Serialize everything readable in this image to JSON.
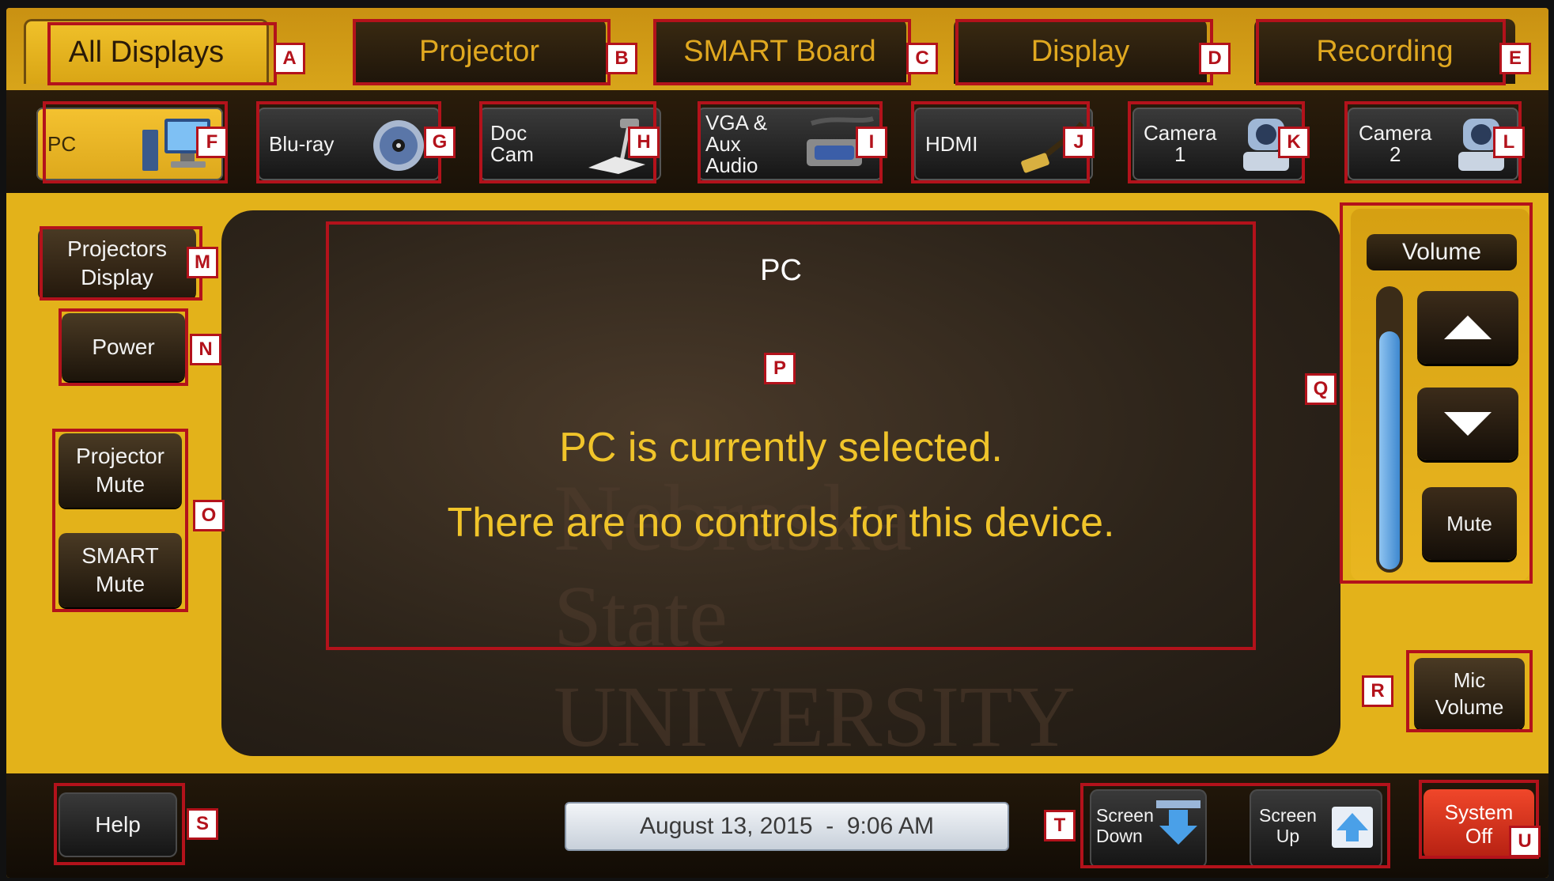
{
  "tabs": [
    {
      "label": "All Displays",
      "badge": "A",
      "active": true
    },
    {
      "label": "Projector",
      "badge": "B"
    },
    {
      "label": "SMART Board",
      "badge": "C"
    },
    {
      "label": "Display",
      "badge": "D"
    },
    {
      "label": "Recording",
      "badge": "E"
    }
  ],
  "sources": [
    {
      "label": "PC",
      "badge": "F",
      "icon": "desktop-computer-icon",
      "active": true
    },
    {
      "label": "Blu-ray",
      "badge": "G",
      "icon": "disc-icon"
    },
    {
      "label": "Doc\nCam",
      "badge": "H",
      "icon": "document-camera-icon"
    },
    {
      "label": "VGA &\nAux\nAudio",
      "badge": "I",
      "icon": "vga-cable-icon"
    },
    {
      "label": "HDMI",
      "badge": "J",
      "icon": "hdmi-cable-icon"
    },
    {
      "label": "Camera\n1",
      "badge": "K",
      "icon": "camera-icon"
    },
    {
      "label": "Camera\n2",
      "badge": "L",
      "icon": "camera-icon"
    }
  ],
  "left": {
    "display_toggle": "Projectors\nDisplay",
    "display_badge": "M",
    "power": "Power",
    "power_badge": "N",
    "projector_mute": "Projector\nMute",
    "smart_mute": "SMART\nMute",
    "mute_badge": "O"
  },
  "screen": {
    "source_title": "PC",
    "badge": "P",
    "message_line1": "PC is currently selected.",
    "message_line2": "There are no controls for this device.",
    "watermark_line1": "Nebraska",
    "watermark_line2": "State UNIVERSITY"
  },
  "volume": {
    "label": "Volume",
    "mute": "Mute",
    "badge": "Q",
    "level": 0.85,
    "up_icon": "triangle-up-icon",
    "down_icon": "triangle-down-icon"
  },
  "mic": {
    "label": "Mic\nVolume",
    "badge": "R"
  },
  "bottom": {
    "help": "Help",
    "help_badge": "S",
    "datetime": "August 13, 2015  -  9:06 AM",
    "screen_down": "Screen\nDown",
    "screen_up": "Screen\nUp",
    "screen_badge": "T",
    "system_off": "System\nOff",
    "system_badge": "U"
  },
  "colors": {
    "panel": "#e3b21a",
    "dark": "#1c140a",
    "accent_text": "#f0c42a",
    "annotation": "#b3121b",
    "system_off": "#e2331c"
  }
}
